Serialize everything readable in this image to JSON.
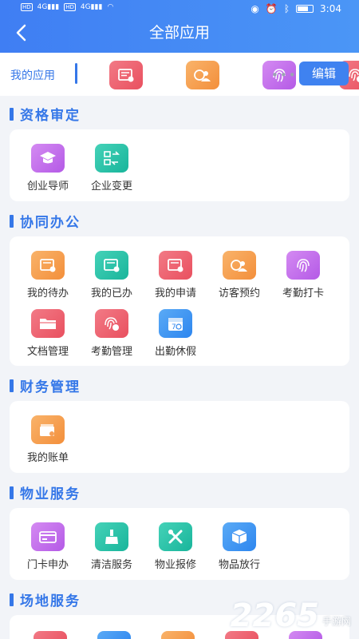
{
  "status_bar": {
    "left_indicators": "HD 4G 4G",
    "time": "3:04"
  },
  "header": {
    "title": "全部应用"
  },
  "my_apps": {
    "label": "我的应用",
    "icons": [
      "document-icon",
      "visitor-icon",
      "fingerprint-icon",
      "fingerprint-settings-icon"
    ],
    "more": "•••",
    "edit_label": "编辑"
  },
  "sections": [
    {
      "title": "资格审定",
      "apps": [
        {
          "label": "创业导师",
          "icon": "graduation-cap-icon",
          "color": "purple"
        },
        {
          "label": "企业变更",
          "icon": "swap-icon",
          "color": "teal"
        }
      ]
    },
    {
      "title": "协同办公",
      "apps": [
        {
          "label": "我的待办",
          "icon": "todo-icon",
          "color": "orange"
        },
        {
          "label": "我的已办",
          "icon": "done-icon",
          "color": "teal"
        },
        {
          "label": "我的申请",
          "icon": "application-icon",
          "color": "red"
        },
        {
          "label": "访客预约",
          "icon": "visitor-icon",
          "color": "orange"
        },
        {
          "label": "考勤打卡",
          "icon": "fingerprint-icon",
          "color": "purple"
        },
        {
          "label": "文档管理",
          "icon": "folder-icon",
          "color": "red"
        },
        {
          "label": "考勤管理",
          "icon": "fingerprint-settings-icon",
          "color": "red"
        },
        {
          "label": "出勤休假",
          "icon": "calendar-icon",
          "color": "blue"
        }
      ]
    },
    {
      "title": "财务管理",
      "apps": [
        {
          "label": "我的账单",
          "icon": "wallet-icon",
          "color": "orange"
        }
      ]
    },
    {
      "title": "物业服务",
      "apps": [
        {
          "label": "门卡申办",
          "icon": "card-icon",
          "color": "purple"
        },
        {
          "label": "清洁服务",
          "icon": "broom-icon",
          "color": "teal"
        },
        {
          "label": "物业报修",
          "icon": "tools-icon",
          "color": "teal"
        },
        {
          "label": "物品放行",
          "icon": "box-icon",
          "color": "blue"
        }
      ]
    },
    {
      "title": "场地服务",
      "apps": []
    }
  ],
  "colors": {
    "accent": "#3577e8",
    "header": "#4287f5",
    "background": "#f2f4f8"
  },
  "watermark": {
    "number": "2265",
    "site": "手游网"
  }
}
